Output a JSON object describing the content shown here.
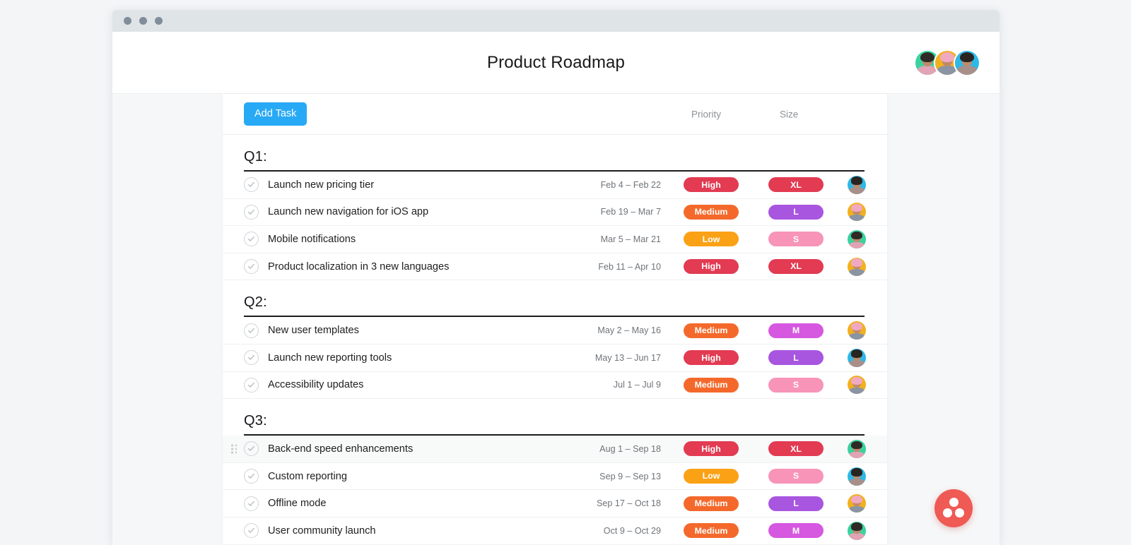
{
  "window": {
    "traffic_lights": [
      "close",
      "minimize",
      "maximize"
    ]
  },
  "header": {
    "title": "Product Roadmap",
    "members": [
      {
        "name": "member-avatar-1",
        "bg": "#3ad29f",
        "hair": "#2f2a26",
        "top": "#e2a3b4"
      },
      {
        "name": "member-avatar-2",
        "bg": "#f2b01e",
        "hair": "#f0a9c0",
        "top": "#8b94a3"
      },
      {
        "name": "member-avatar-3",
        "bg": "#2fb8e6",
        "hair": "#2a2420",
        "top": "#a98f8a"
      }
    ]
  },
  "toolbar": {
    "add_task_label": "Add Task",
    "priority_header": "Priority",
    "size_header": "Size"
  },
  "colors": {
    "accent_blue": "#28a9f5",
    "priority_high": "#e23b52",
    "priority_medium": "#f4692b",
    "priority_low": "#fba116",
    "size_xl": "#e23b52",
    "size_l": "#a855e0",
    "size_m": "#d657e0",
    "size_s": "#f794b8",
    "fab": "#ef5a55"
  },
  "sections": [
    {
      "title": "Q1:",
      "tasks": [
        {
          "name": "Launch new pricing tier",
          "dates": "Feb 4 – Feb 22",
          "priority": "High",
          "priority_color": "#e23b52",
          "size": "XL",
          "size_color": "#e23b52",
          "avatar": {
            "bg": "#2fb8e6",
            "hair": "#2a2420",
            "top": "#a98f8a"
          },
          "highlight": false,
          "grip": false
        },
        {
          "name": "Launch new navigation for iOS app",
          "dates": "Feb 19 – Mar 7",
          "priority": "Medium",
          "priority_color": "#f4692b",
          "size": "L",
          "size_color": "#a855e0",
          "avatar": {
            "bg": "#f2b01e",
            "hair": "#f0a9c0",
            "top": "#8b94a3"
          },
          "highlight": false,
          "grip": false
        },
        {
          "name": "Mobile notifications",
          "dates": "Mar 5 – Mar 21",
          "priority": "Low",
          "priority_color": "#fba116",
          "size": "S",
          "size_color": "#f794b8",
          "avatar": {
            "bg": "#3ad29f",
            "hair": "#2f2a26",
            "top": "#e2a3b4"
          },
          "highlight": false,
          "grip": false
        },
        {
          "name": "Product localization in 3 new languages",
          "dates": "Feb 11 – Apr 10",
          "priority": "High",
          "priority_color": "#e23b52",
          "size": "XL",
          "size_color": "#e23b52",
          "avatar": {
            "bg": "#f2b01e",
            "hair": "#f0a9c0",
            "top": "#8b94a3"
          },
          "highlight": false,
          "grip": false
        }
      ]
    },
    {
      "title": "Q2:",
      "tasks": [
        {
          "name": "New user templates",
          "dates": "May 2 – May 16",
          "priority": "Medium",
          "priority_color": "#f4692b",
          "size": "M",
          "size_color": "#d657e0",
          "avatar": {
            "bg": "#f2b01e",
            "hair": "#f0a9c0",
            "top": "#8b94a3"
          },
          "highlight": false,
          "grip": false
        },
        {
          "name": "Launch new reporting tools",
          "dates": "May 13 – Jun 17",
          "priority": "High",
          "priority_color": "#e23b52",
          "size": "L",
          "size_color": "#a855e0",
          "avatar": {
            "bg": "#2fb8e6",
            "hair": "#2a2420",
            "top": "#a98f8a"
          },
          "highlight": false,
          "grip": false
        },
        {
          "name": "Accessibility updates",
          "dates": "Jul 1 – Jul 9",
          "priority": "Medium",
          "priority_color": "#f4692b",
          "size": "S",
          "size_color": "#f794b8",
          "avatar": {
            "bg": "#f2b01e",
            "hair": "#f0a9c0",
            "top": "#8b94a3"
          },
          "highlight": false,
          "grip": false
        }
      ]
    },
    {
      "title": "Q3:",
      "tasks": [
        {
          "name": "Back-end speed enhancements",
          "dates": "Aug 1 – Sep 18",
          "priority": "High",
          "priority_color": "#e23b52",
          "size": "XL",
          "size_color": "#e23b52",
          "avatar": {
            "bg": "#3ad29f",
            "hair": "#2f2a26",
            "top": "#e2a3b4"
          },
          "highlight": true,
          "grip": true
        },
        {
          "name": "Custom reporting",
          "dates": "Sep 9 – Sep 13",
          "priority": "Low",
          "priority_color": "#fba116",
          "size": "S",
          "size_color": "#f794b8",
          "avatar": {
            "bg": "#2fb8e6",
            "hair": "#2a2420",
            "top": "#a98f8a"
          },
          "highlight": false,
          "grip": false
        },
        {
          "name": "Offline mode",
          "dates": "Sep 17 – Oct 18",
          "priority": "Medium",
          "priority_color": "#f4692b",
          "size": "L",
          "size_color": "#a855e0",
          "avatar": {
            "bg": "#f2b01e",
            "hair": "#f0a9c0",
            "top": "#8b94a3"
          },
          "highlight": false,
          "grip": false
        },
        {
          "name": "User community launch",
          "dates": "Oct 9 – Oct 29",
          "priority": "Medium",
          "priority_color": "#f4692b",
          "size": "M",
          "size_color": "#d657e0",
          "avatar": {
            "bg": "#3ad29f",
            "hair": "#2f2a26",
            "top": "#e2a3b4"
          },
          "highlight": false,
          "grip": false
        }
      ]
    }
  ],
  "fab": {
    "label": "asana-logo-icon"
  }
}
